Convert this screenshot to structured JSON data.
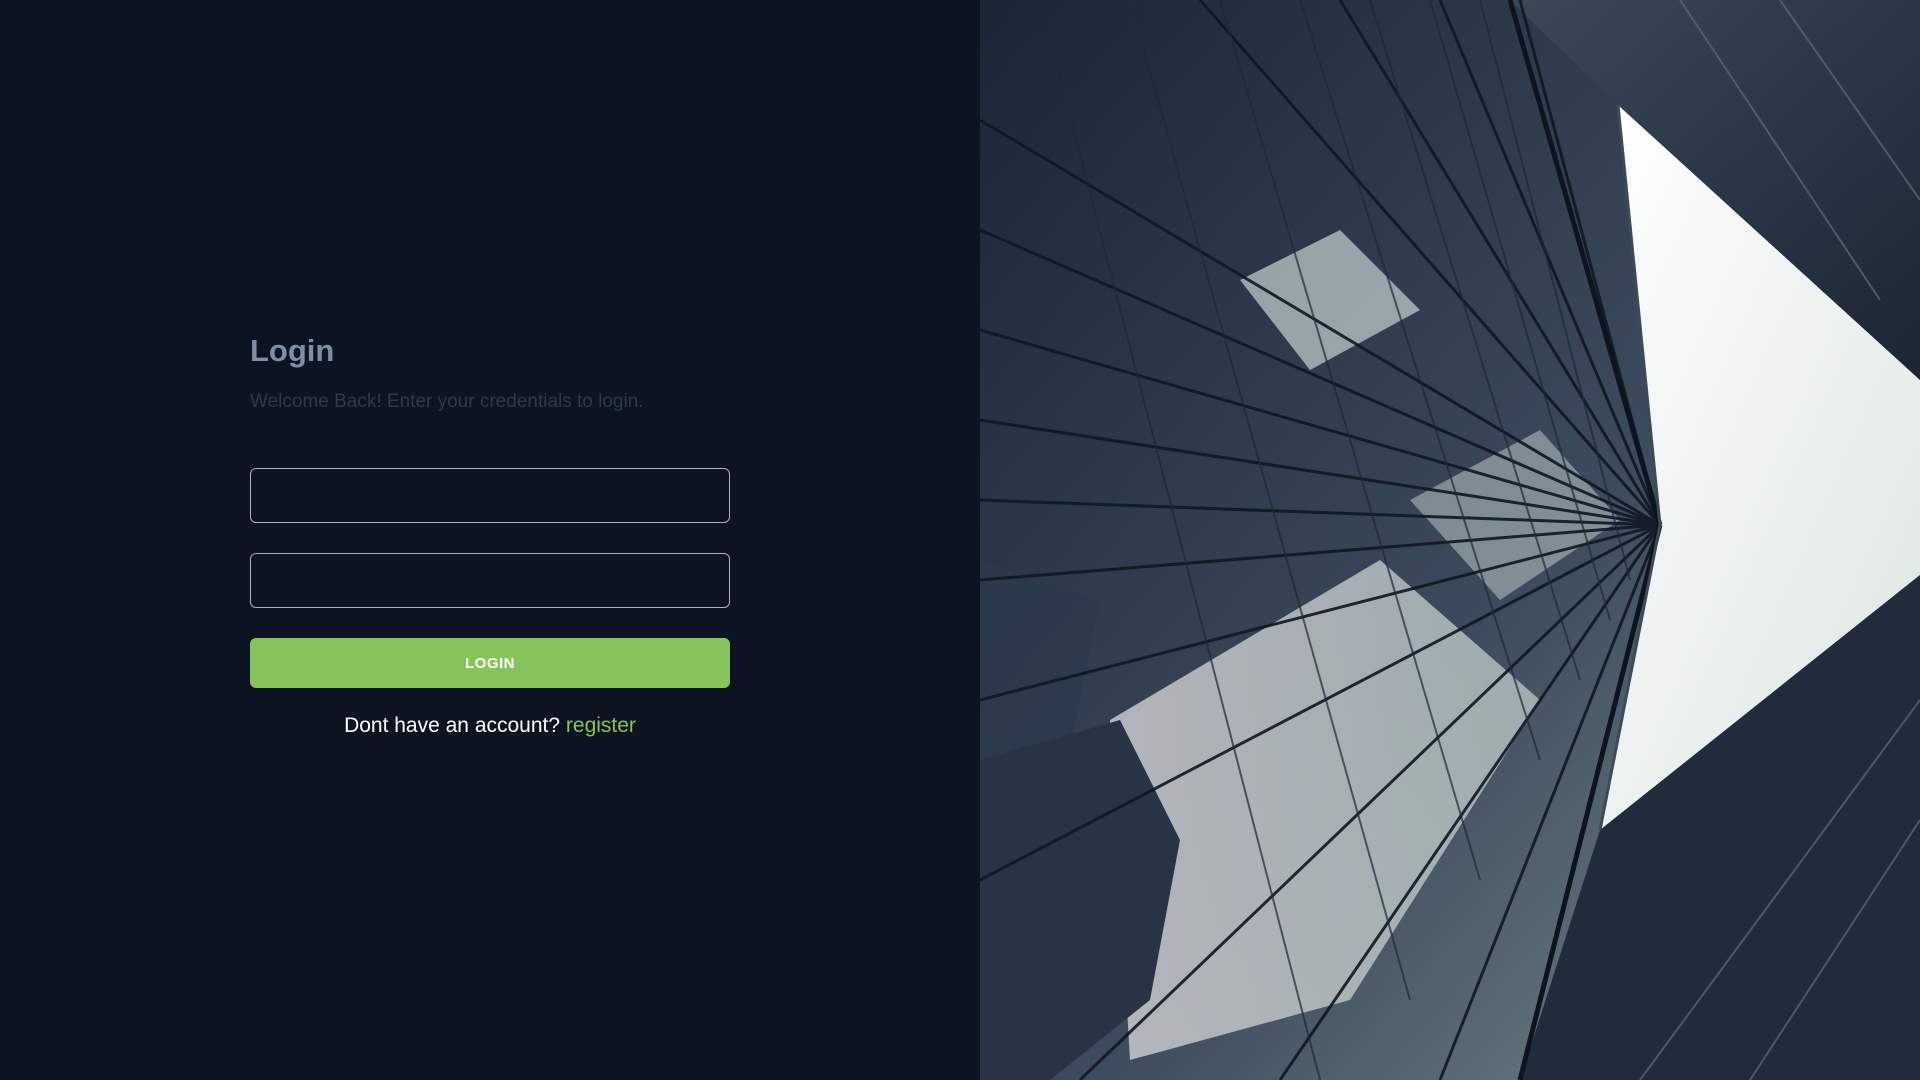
{
  "login": {
    "title": "Login",
    "subtitle": "Welcome Back! Enter your credentials to login.",
    "username": {
      "value": "",
      "placeholder": ""
    },
    "password": {
      "value": "",
      "placeholder": ""
    },
    "button_label": "LOGIN",
    "register_prompt": "Dont have an account?",
    "register_link": "register"
  },
  "photo": {
    "subject": "skyscraper-glass-facade-looking-up-image"
  },
  "colors": {
    "background": "#0b1420",
    "title": "#7d8ea6",
    "accent": "#84c45a",
    "field_border": "#aab3c0"
  }
}
